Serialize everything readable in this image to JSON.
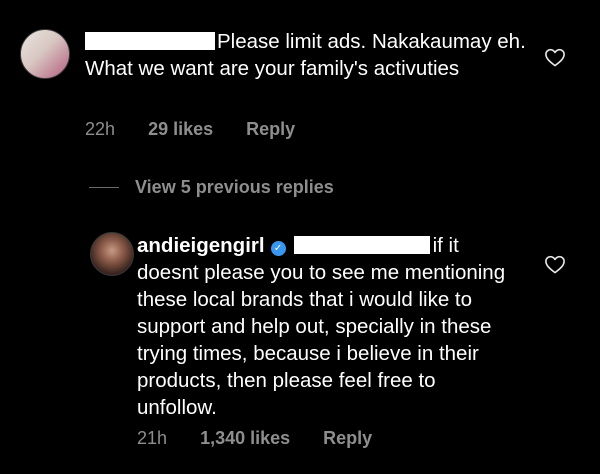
{
  "comment1": {
    "text": "Please limit ads. Nakakaumay eh. What we want are your family's activuties",
    "time": "22h",
    "likes": "29 likes",
    "reply_label": "Reply"
  },
  "view_replies": "View 5 previous replies",
  "comment2": {
    "username": "andieigengirl",
    "text": "if it doesnt please you to see me mentioning these local brands that i would like to support and help out, specially in these trying times, because i believe in their products, then please feel free to unfollow.",
    "time": "21h",
    "likes": "1,340 likes",
    "reply_label": "Reply"
  },
  "icons": {
    "heart": "heart-outline-icon",
    "verified": "verified-badge-icon"
  },
  "colors": {
    "background": "#000000",
    "meta_text": "#8e8e8e",
    "verified": "#3897f0"
  }
}
